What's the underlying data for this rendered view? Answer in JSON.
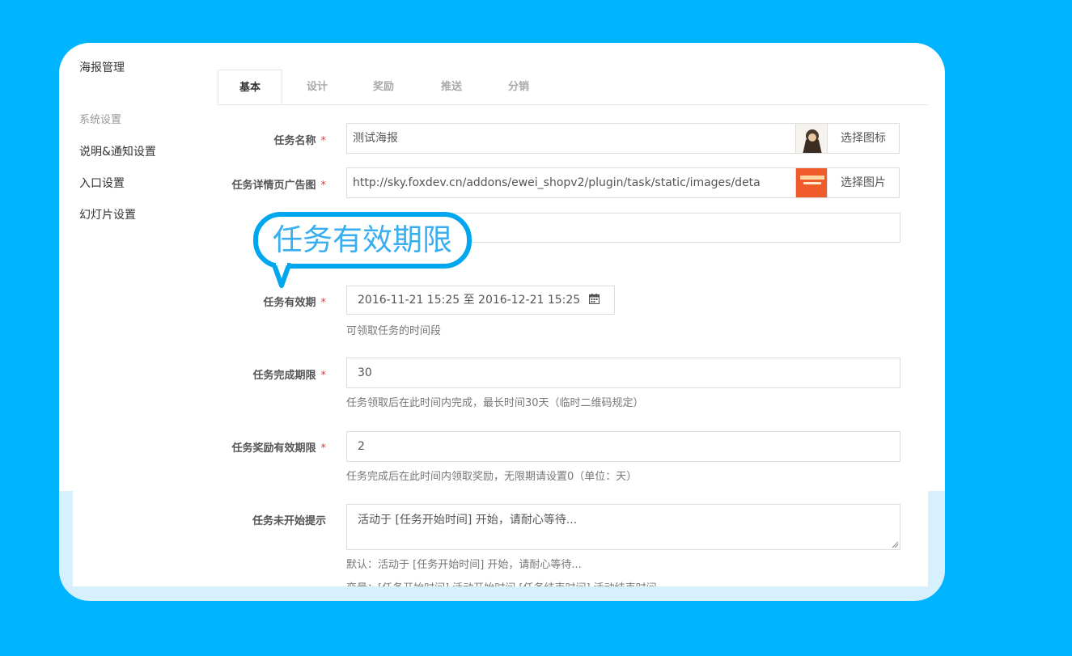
{
  "sidebar": {
    "title": "海报管理",
    "section_label": "系统设置",
    "items": [
      {
        "label": "说明&通知设置"
      },
      {
        "label": "入口设置"
      },
      {
        "label": "幻灯片设置"
      }
    ]
  },
  "tabs": [
    {
      "label": "基本",
      "active": true
    },
    {
      "label": "设计"
    },
    {
      "label": "奖励"
    },
    {
      "label": "推送"
    },
    {
      "label": "分销"
    }
  ],
  "form": {
    "task_name": {
      "label": "任务名称",
      "value": "测试海报",
      "button": "选择图标"
    },
    "task_ad_image": {
      "label": "任务详情页广告图",
      "value": "http://sky.foxdev.cn/addons/ewei_shopv2/plugin/task/static/images/deta",
      "button": "选择图片"
    },
    "task_validity": {
      "label": "任务有效期",
      "value": "2016-11-21 15:25 至 2016-12-21 15:25",
      "help": "可领取任务的时间段"
    },
    "task_deadline": {
      "label": "任务完成期限",
      "value": "30",
      "help": "任务领取后在此时间内完成，最长时间30天（临时二维码规定）"
    },
    "reward_deadline": {
      "label": "任务奖励有效期限",
      "value": "2",
      "help": "任务完成后在此时间内领取奖励，无限期请设置0（单位：天）"
    },
    "not_started_tip": {
      "label": "任务未开始提示",
      "value": "活动于 [任务开始时间] 开始，请耐心等待...",
      "help": "默认：活动于 [任务开始时间] 开始，请耐心等待...",
      "help2": "变量：[任务开始时间] 活动开始时间 [任务结束时间] 活动结束时间"
    }
  },
  "callout": {
    "text": "任务有效期限"
  },
  "required_mark": "*",
  "colors": {
    "background": "#00b4ff",
    "callout_border": "#00a7ee",
    "required": "#e33333"
  }
}
